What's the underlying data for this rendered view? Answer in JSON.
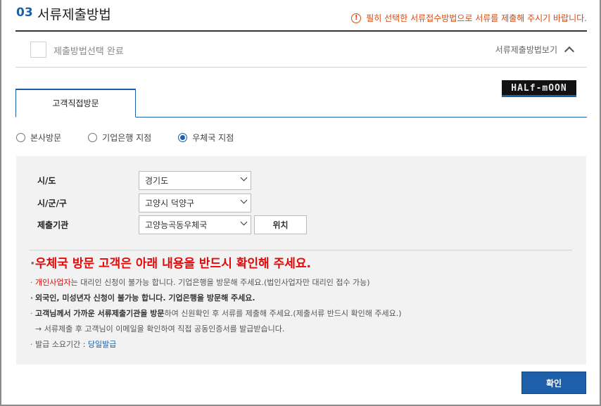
{
  "header": {
    "step_number": "03",
    "title": "서류제출방법",
    "notice_icon": "info-circle-icon",
    "notice": "필히 선택한 서류접수방법으로 서류를 제출해 주시기 바랍니다."
  },
  "done_row": {
    "label": "제출방법선택 완료",
    "view_toggle": "서류제출방법보기"
  },
  "logo_text": "HALf-mOON",
  "tabs": [
    {
      "label": "고객직접방문",
      "active": true
    }
  ],
  "radios": [
    {
      "label": "본사방문",
      "checked": false
    },
    {
      "label": "기업은행 지점",
      "checked": false
    },
    {
      "label": "우체국 지점",
      "checked": true
    }
  ],
  "form": {
    "sido_label": "시/도",
    "sido_value": "경기도",
    "sigungu_label": "시/군/구",
    "sigungu_value": "고양시 덕양구",
    "office_label": "제출기관",
    "office_value": "고양능곡동우체국",
    "location_button": "위치"
  },
  "info": {
    "headline": "우체국 방문 고객은 아래 내용을 반드시 확인해 주세요.",
    "line1_highlight": "개인사업자",
    "line1_rest": "는 대리인 신청이 불가능 합니다. 기업은행을 방문해 주세요.(법인사업자만 대리인 접수 가능)",
    "line2": "외국인, 미성년자 신청이 불가능 합니다. 기업은행을 방문해 주세요.",
    "line3_bold": "고객님께서 가까운 서류제출기관을 방문",
    "line3_rest": "하여 신원확인 후 서류를 제출해 주세요.(제출서류 반드시 확인해 주세요.)",
    "line4": "→ 서류제출 후 고객님이 이메일을 확인하여 직접 공동인증서를 발급받습니다.",
    "line5_label": "발급 소요기간 : ",
    "line5_value": "당일발급"
  },
  "confirm_button": "확인",
  "colors": {
    "accent": "#1d5fa8",
    "warning": "#d9480f",
    "alert": "#e20a0a"
  }
}
